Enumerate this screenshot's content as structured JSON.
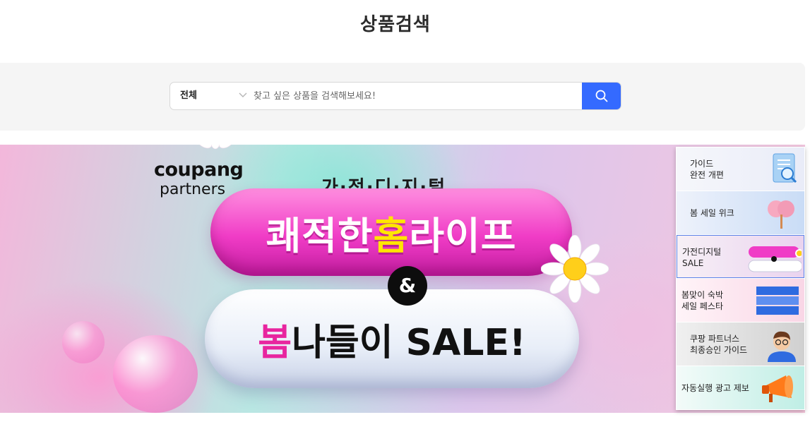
{
  "header": {
    "title": "상품검색"
  },
  "search": {
    "category_selected": "전체",
    "placeholder": "찾고 싶은 상품을 검색해보세요!",
    "value": ""
  },
  "banner": {
    "logo_line1": "coupang",
    "logo_line2": "partners",
    "subheadline": "가·전·디·지·털",
    "headline1_pre": "쾌적한 ",
    "headline1_hl": "홈",
    "headline1_post": "라이프",
    "ampersand": "&",
    "headline2_hl": "봄",
    "headline2_post": "나들이 SALE!"
  },
  "sidebar": {
    "items": [
      {
        "label": "가이드\n완전 개편",
        "icon": "guide-document-icon",
        "bg": "#eef0f8"
      },
      {
        "label": "봄 세일 위크",
        "icon": "spring-tree-icon",
        "bg": "#dfe9f8"
      },
      {
        "label": "가전디지털\nSALE",
        "icon": "home-life-sale-thumbnail",
        "bg": "#f0e4f2"
      },
      {
        "label": "봄맞이 숙박\n세일 페스타",
        "icon": "hotel-sale-fest-thumbnail",
        "bg": "#fbe3ee"
      },
      {
        "label": "쿠팡 파트너스\n최종승인 가이드",
        "icon": "partner-avatar-icon",
        "bg": "#e6e6e6"
      },
      {
        "label": "자동실행 광고 제보",
        "icon": "megaphone-icon",
        "bg": "#d7f4ef"
      }
    ]
  },
  "colors": {
    "accent": "#346aff",
    "pink": "#f03cc6",
    "highlight_yellow": "#ffe600",
    "active_border": "#5a82e8"
  }
}
